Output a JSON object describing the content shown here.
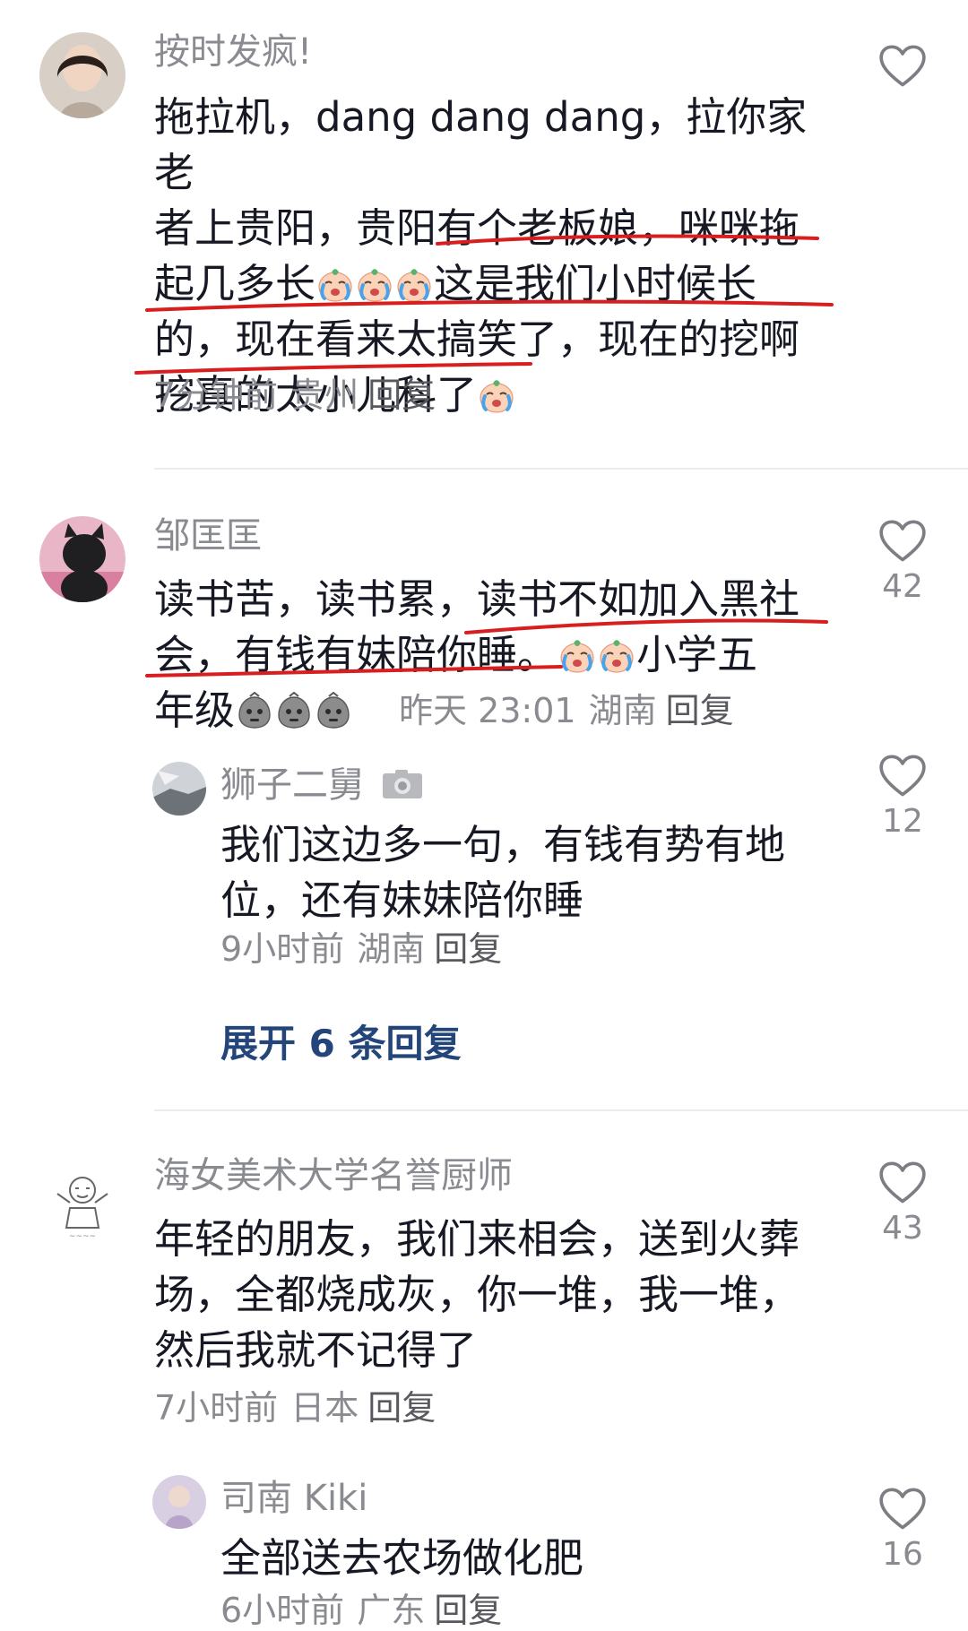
{
  "comments": [
    {
      "username": "按时发疯!",
      "text_parts": [
        "拖拉机，dang dang dang，拉你家老\n者上贵阳，贵阳有个老板娘，咪咪拖\n起几多长",
        "这是我们小时候长\n的，现在看来太搞笑了，现在的挖啊\n挖真的太小儿科了"
      ],
      "time": "7分钟前",
      "location": "贵州",
      "reply_label": "回复"
    },
    {
      "username": "邹匡匡",
      "text_part1": "读书苦，读书累，读书不如加入黑社\n会，有钱有妹陪你睡。",
      "text_part2": "小学五\n年级",
      "time": "昨天 23:01",
      "location": "湖南",
      "reply_label": "回复",
      "likes": "42",
      "reply": {
        "username": "狮子二舅",
        "text": "我们这边多一句，有钱有势有地\n位，还有妹妹陪你睡",
        "time": "9小时前",
        "location": "湖南",
        "reply_label": "回复",
        "likes": "12"
      },
      "expand_label": "展开 6 条回复"
    },
    {
      "username": "海女美术大学名誉厨师",
      "text": "年轻的朋友，我们来相会，送到火葬\n场，全都烧成灰，你一堆，我一堆，\n然后我就不记得了",
      "time": "7小时前",
      "location": "日本",
      "reply_label": "回复",
      "likes": "43",
      "reply": {
        "username": "司南 Kiki",
        "text": "全部送去农场做化肥",
        "time": "6小时前",
        "location": "广东",
        "reply_label": "回复",
        "likes": "16"
      }
    }
  ],
  "icons": {
    "like": "heart-outline-icon",
    "emoji_cry": "crying-emoji-icon",
    "emoji_speechless": "speechless-emoji-icon",
    "camera": "camera-icon"
  },
  "colors": {
    "text": "#161823",
    "meta": "#8a8b91",
    "expand": "#23457a",
    "annotation": "#d81e1e"
  }
}
